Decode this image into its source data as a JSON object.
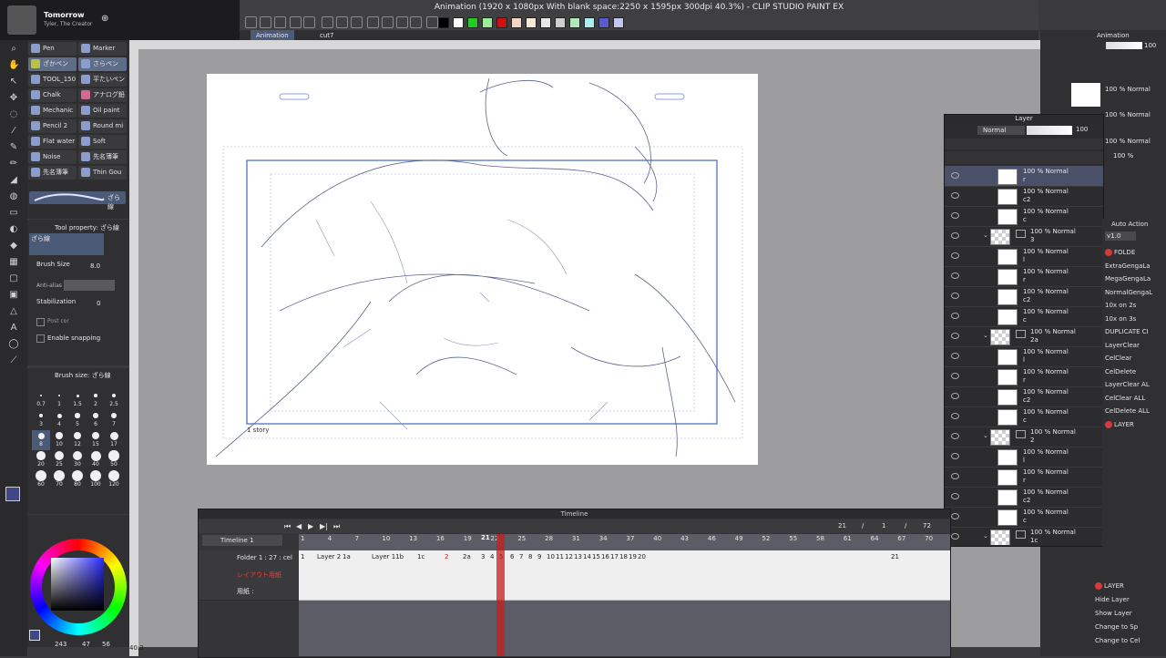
{
  "media": {
    "title": "Tomorrow",
    "artist": "Tyler, The Creator"
  },
  "window": {
    "title": "Animation (1920 x 1080px With blank space:2250 x 1595px 300dpi 40.3%) - CLIP STUDIO PAINT EX"
  },
  "colors": {
    "accent": "#5d6d8a",
    "canvas": "#ffffff",
    "workspace": "#9d9da0",
    "playhead": "#c81e1e",
    "frame_guide": "#4466bb"
  },
  "palette": [
    "#000000",
    "#ffffff",
    "#22cc22",
    "#99ee99",
    "#cc1111",
    "#f5d5c5",
    "#f5e8d5",
    "#e8e8e8",
    "#cfcfcf",
    "#aee8bb",
    "#aeeeee",
    "#5a5ad0",
    "#c5c5f0"
  ],
  "doc_tabs": [
    "Animation",
    "cut7"
  ],
  "subtools": [
    "Pen",
    "Marker",
    "ざかペン",
    "さらペン",
    "TOOL_150",
    "平たいペン",
    "Chalk",
    "アナログ鉛",
    "Mechanic",
    "Oil paint",
    "Pencil 2",
    "Round mi",
    "Flat water",
    "Soft",
    "Noise",
    "先名薄筆",
    "先名薄筆",
    "Thin Gou"
  ],
  "tool_property": {
    "title": "Tool property: ざら線",
    "brush_name": "ざら線",
    "brush_size_label": "Brush Size",
    "brush_size_value": "8.0",
    "anti_alias_label": "Anti-alias",
    "stabilization_label": "Stabilization",
    "stabilization_value": "0",
    "post_correction": "Post cor",
    "enable_snapping": "Enable snapping"
  },
  "brush_size_panel": {
    "title": "Brush size: ざら線",
    "sizes": [
      "0.7",
      "1",
      "1.5",
      "2",
      "2.5",
      "3",
      "4",
      "5",
      "6",
      "7",
      "8",
      "10",
      "12",
      "15",
      "17",
      "20",
      "25",
      "30",
      "40",
      "50",
      "60",
      "70",
      "80",
      "100",
      "120"
    ]
  },
  "color_panel": {
    "readout_a": "243",
    "readout_b": "47",
    "readout_c": "56"
  },
  "zoom": "40.3",
  "canvas": {
    "story_label": "1 story"
  },
  "layer_panel": {
    "title": "Layer",
    "blend": "Normal",
    "opacity": "100",
    "rows": [
      {
        "name": "100 % Normal",
        "sub": "r",
        "type": "white",
        "indent": 0,
        "selected": true
      },
      {
        "name": "100 % Normal",
        "sub": "c2",
        "type": "white",
        "indent": 0
      },
      {
        "name": "100 % Normal",
        "sub": "c",
        "type": "white",
        "indent": 0
      },
      {
        "name": "100 % Normal",
        "sub": "3",
        "type": "folder",
        "indent": 1
      },
      {
        "name": "100 % Normal",
        "sub": "l",
        "type": "white",
        "indent": 0
      },
      {
        "name": "100 % Normal",
        "sub": "r",
        "type": "white",
        "indent": 0
      },
      {
        "name": "100 % Normal",
        "sub": "c2",
        "type": "white",
        "indent": 0
      },
      {
        "name": "100 % Normal",
        "sub": "c",
        "type": "white",
        "indent": 0
      },
      {
        "name": "100 % Normal",
        "sub": "2a",
        "type": "folder",
        "indent": 1
      },
      {
        "name": "100 % Normal",
        "sub": "l",
        "type": "white",
        "indent": 0
      },
      {
        "name": "100 % Normal",
        "sub": "r",
        "type": "white",
        "indent": 0
      },
      {
        "name": "100 % Normal",
        "sub": "c2",
        "type": "white",
        "indent": 0
      },
      {
        "name": "100 % Normal",
        "sub": "c",
        "type": "white",
        "indent": 0
      },
      {
        "name": "100 % Normal",
        "sub": "2",
        "type": "folder",
        "indent": 1
      },
      {
        "name": "100 % Normal",
        "sub": "l",
        "type": "white",
        "indent": 0
      },
      {
        "name": "100 % Normal",
        "sub": "r",
        "type": "white",
        "indent": 0
      },
      {
        "name": "100 % Normal",
        "sub": "c2",
        "type": "white",
        "indent": 0
      },
      {
        "name": "100 % Normal",
        "sub": "c",
        "type": "white",
        "indent": 0
      },
      {
        "name": "100 % Normal",
        "sub": "1c",
        "type": "folder",
        "indent": 1
      }
    ]
  },
  "top_right": {
    "tab": "Animation",
    "opacity": "100",
    "rows": [
      "100 % Normal",
      "100 % Normal",
      "100 % Normal",
      "100 %"
    ]
  },
  "auto_action": {
    "title": "Auto Action",
    "set": "v1.0",
    "items": [
      "FOLDE",
      "ExtraGengaLa",
      "MegaGengaLa",
      "NormalGengaL",
      "10x on 2s",
      "10x on 3s",
      "DUPLICATE CI",
      "LayerClear",
      "CelClear",
      "CelDelete",
      "LayerClear AL",
      "CelClear ALL",
      "CelDelete ALL",
      "LAYER"
    ]
  },
  "bottom_right": {
    "items": [
      "LAYER",
      "Hide Layer",
      "Show Layer",
      "Change to Sp",
      "Change to Cel"
    ]
  },
  "timeline": {
    "title": "Timeline",
    "name": "Timeline 1",
    "current": "21",
    "sep1": "/",
    "start": "1",
    "sep2": "/",
    "end": "72",
    "ruler": [
      "1",
      "4",
      "7",
      "10",
      "13",
      "16",
      "19",
      "22",
      "25",
      "28",
      "31",
      "34",
      "37",
      "40",
      "43",
      "46",
      "49",
      "52",
      "55",
      "58",
      "61",
      "64",
      "67",
      "70"
    ],
    "playhead_label": "21",
    "tracks": [
      {
        "label": "Folder 1 : 27 : cel"
      },
      {
        "label": "レイアウト用紙"
      },
      {
        "label": "用紙 :"
      }
    ],
    "cels": [
      "1",
      "Layer 2",
      "1a",
      "Layer 11b",
      "1c",
      "2",
      "2a",
      "3",
      "4",
      "5",
      "6",
      "7",
      "8",
      "9",
      "10",
      "11",
      "12",
      "13",
      "14",
      "15",
      "16",
      "17",
      "18",
      "19",
      "20",
      "21"
    ]
  }
}
